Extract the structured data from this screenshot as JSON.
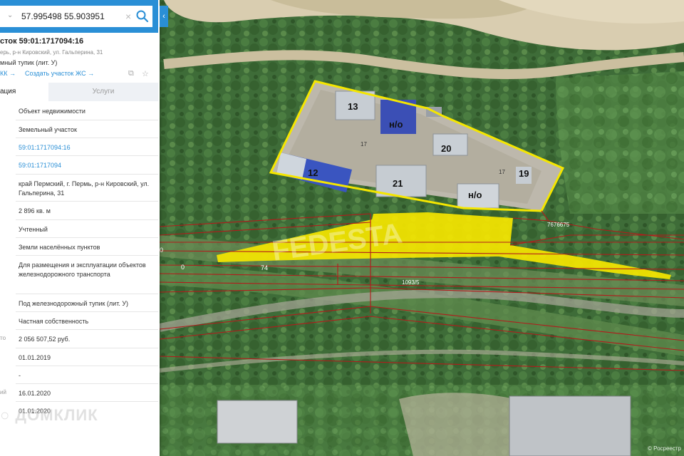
{
  "search": {
    "value": "57.995498 55.903951"
  },
  "header": {
    "title": "сток 59:01:1717094:16",
    "address": "ерь, р-н Кировский, ул. Гальперина, 31",
    "subtitle": "мный тупик (лит. У)",
    "link_kk": "КК →",
    "link_create": "Создать участок ЖС →"
  },
  "tabs": {
    "active": "ация",
    "inactive": "Услуги"
  },
  "rows": [
    {
      "label": "",
      "value": "Объект недвижимости",
      "link": false
    },
    {
      "label": "",
      "value": "Земельный участок",
      "link": false
    },
    {
      "label": "",
      "value": "59:01:1717094:16",
      "link": true
    },
    {
      "label": "",
      "value": "59:01:1717094",
      "link": true
    },
    {
      "label": "",
      "value": "край Пермский, г. Пермь, р-н Кировский, ул. Гальперина, 31",
      "link": false
    },
    {
      "label": "",
      "value": "2 896 кв. м",
      "link": false
    },
    {
      "label": "",
      "value": "Учтенный",
      "link": false
    },
    {
      "label": "",
      "value": "Земли населённых пунктов",
      "link": false
    },
    {
      "label": "",
      "value": "Для размещения и эксплуатации объектов железнодорожного транспорта",
      "link": false
    },
    {
      "label": "",
      "value": "Под железнодорожный тупик (лит. У)",
      "link": false
    },
    {
      "label": "",
      "value": "Частная собственность",
      "link": false
    },
    {
      "label": "то",
      "value": "2 056 507,52 руб.",
      "link": false
    },
    {
      "label": "",
      "value": "01.01.2019",
      "link": false
    },
    {
      "label": "",
      "value": "-",
      "link": false
    },
    {
      "label": "ий",
      "value": "16.01.2020",
      "link": false
    },
    {
      "label": "",
      "value": "01.01.2020",
      "link": false
    }
  ],
  "watermark": "ДОМКЛИК",
  "map": {
    "building_labels": [
      "13",
      "н/о",
      "20",
      "12",
      "21",
      "н/о",
      "19"
    ],
    "parcel_labels": [
      "17",
      "17",
      "7676675",
      "1093/5",
      "74",
      "0",
      "0"
    ],
    "watermark": "FEDESTA",
    "copyright": "© Росреестр",
    "highlight_color": "#f5e600",
    "parcel_line_color": "#b31b1b"
  }
}
